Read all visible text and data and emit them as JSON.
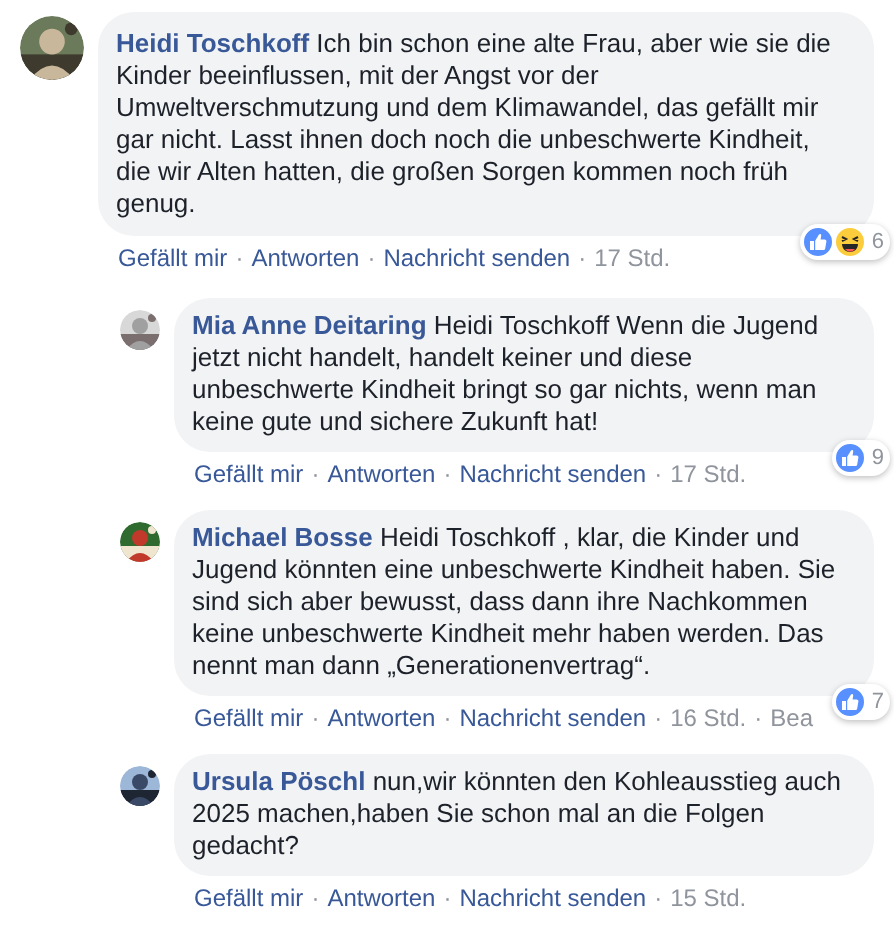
{
  "separator": "·",
  "comments": [
    {
      "author": "Heidi Toschkoff",
      "text": "Ich bin schon eine alte Frau, aber wie sie die Kinder beeinflussen, mit der Angst vor der Umweltverschmutzung und dem Klimawandel, das gefällt mir gar nicht. Lasst ihnen doch noch die unbeschwerte Kindheit, die wir Alten hatten, die großen Sorgen kommen noch früh genug.",
      "actions": [
        "Gefällt mir",
        "Antworten",
        "Nachricht senden"
      ],
      "time": "17 Std.",
      "reactions": {
        "icons": [
          {
            "kind": "like"
          },
          {
            "kind": "haha"
          }
        ],
        "count": "6"
      },
      "replies": [
        {
          "author": "Mia Anne Deitaring",
          "text": "Heidi Toschkoff Wenn die Jugend jetzt nicht handelt, handelt keiner und diese unbeschwerte Kindheit bringt so gar nichts, wenn man keine gute und sichere Zukunft hat!",
          "actions": [
            "Gefällt mir",
            "Antworten",
            "Nachricht senden"
          ],
          "time": "17 Std.",
          "reactions": {
            "icons": [
              {
                "kind": "like"
              }
            ],
            "count": "9"
          }
        },
        {
          "author": "Michael Bosse",
          "text": "Heidi Toschkoff , klar, die Kinder und Jugend könnten eine unbeschwerte Kindheit haben. Sie sind sich aber bewusst, dass dann ihre Nachkommen keine unbeschwerte Kindheit mehr haben werden. Das nennt man dann „Generationenvertrag“.",
          "actions": [
            "Gefällt mir",
            "Antworten",
            "Nachricht senden"
          ],
          "time": "16 Std.",
          "status": "Bea",
          "reactions": {
            "icons": [
              {
                "kind": "like"
              }
            ],
            "count": "7"
          }
        },
        {
          "author": "Ursula Pöschl",
          "text": "nun,wir könnten den Kohleausstieg auch 2025 machen,haben Sie schon mal an die Folgen gedacht?",
          "actions": [
            "Gefällt mir",
            "Antworten",
            "Nachricht senden"
          ],
          "time": "15 Std."
        }
      ]
    }
  ]
}
